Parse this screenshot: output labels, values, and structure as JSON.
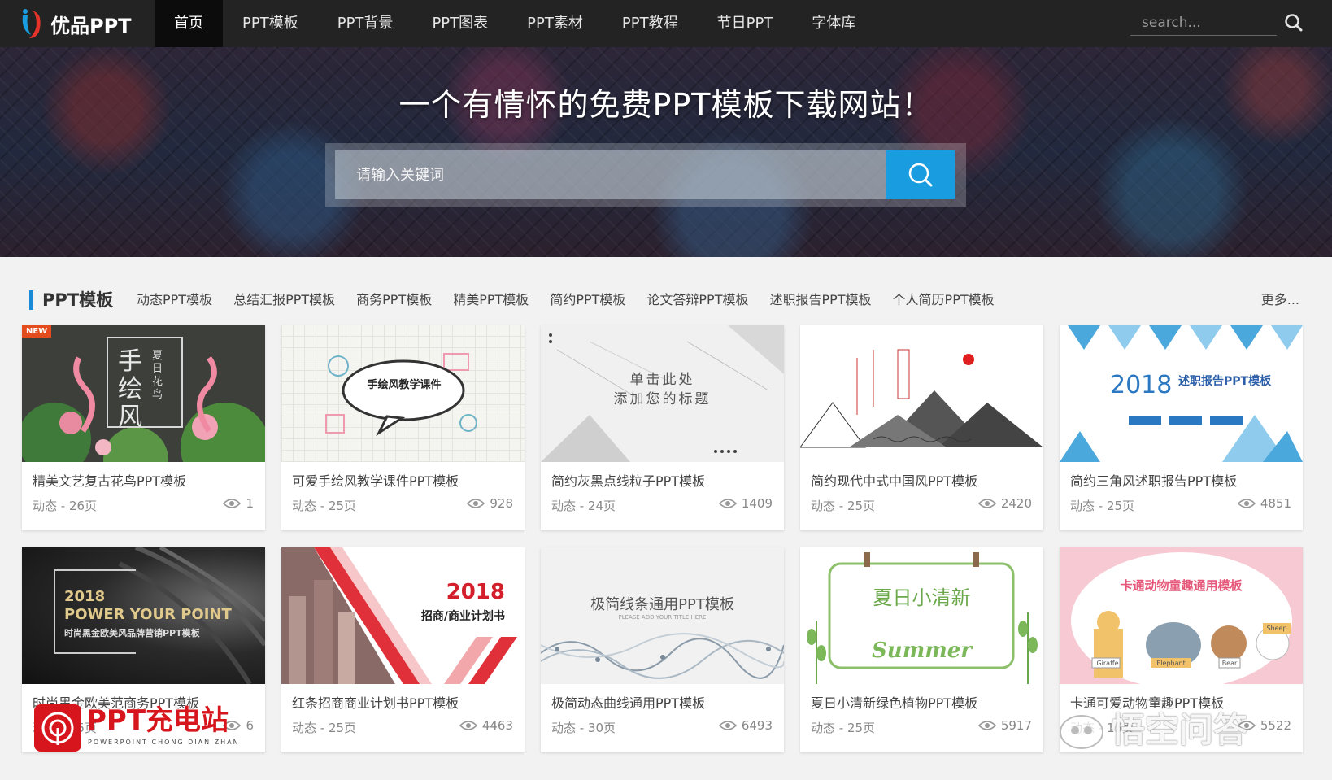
{
  "nav": {
    "logo_text": "优品PPT",
    "items": [
      {
        "label": "首页"
      },
      {
        "label": "PPT模板"
      },
      {
        "label": "PPT背景"
      },
      {
        "label": "PPT图表"
      },
      {
        "label": "PPT素材"
      },
      {
        "label": "PPT教程"
      },
      {
        "label": "节日PPT"
      },
      {
        "label": "字体库"
      }
    ],
    "search_placeholder": "search..."
  },
  "hero": {
    "title": "一个有情怀的免费PPT模板下载网站！",
    "search_placeholder": "请输入关键词"
  },
  "category": {
    "title": "PPT模板",
    "links": [
      "动态PPT模板",
      "总结汇报PPT模板",
      "商务PPT模板",
      "精美PPT模板",
      "简约PPT模板",
      "论文答辩PPT模板",
      "述职报告PPT模板",
      "个人简历PPT模板"
    ],
    "more": "更多..."
  },
  "cards": [
    {
      "title": "精美文艺复古花鸟PPT模板",
      "meta": "动态 - 26页",
      "views": "1",
      "badge": "NEW",
      "thumb_text": [
        "手绘风",
        "夏日花鸟"
      ]
    },
    {
      "title": "可爱手绘风教学课件PPT模板",
      "meta": "动态 - 25页",
      "views": "928",
      "thumb_text": [
        "手绘风教学课件"
      ]
    },
    {
      "title": "简约灰黑点线粒子PPT模板",
      "meta": "动态 - 24页",
      "views": "1409",
      "thumb_text": [
        "单击此处",
        "添加您的标题"
      ]
    },
    {
      "title": "简约现代中式中国风PPT模板",
      "meta": "动态 - 25页",
      "views": "2420",
      "thumb_text": []
    },
    {
      "title": "简约三角风述职报告PPT模板",
      "meta": "动态 - 25页",
      "views": "4851",
      "thumb_text": [
        "2018",
        "述职报告PPT模板"
      ]
    },
    {
      "title": "时尚黑金欧美范商务PPT模板",
      "meta": "动态 - 25页",
      "views": "6",
      "thumb_text": [
        "2018",
        "POWER YOUR POINT",
        "时尚黑金欧美风品牌营销PPT模板"
      ]
    },
    {
      "title": "红条招商商业计划书PPT模板",
      "meta": "动态 - 25页",
      "views": "4463",
      "thumb_text": [
        "2018",
        "招商/商业计划书"
      ]
    },
    {
      "title": "极简动态曲线通用PPT模板",
      "meta": "动态 - 30页",
      "views": "6493",
      "thumb_text": [
        "极简线条通用PPT模板",
        "PLEASE ADD YOUR TITLE HERE"
      ]
    },
    {
      "title": "夏日小清新绿色植物PPT模板",
      "meta": "动态 - 25页",
      "views": "5917",
      "thumb_text": [
        "夏日小清新",
        "Summer"
      ]
    },
    {
      "title": "卡通可爱动物童趣PPT模板",
      "meta": "动态 - 15页",
      "views": "5522",
      "thumb_text": [
        "卡通动物童趣通用模板",
        "Giraffe",
        "Elephant",
        "Bear",
        "Sheep"
      ]
    }
  ],
  "watermarks": {
    "left_text": "PPT充电站",
    "left_sub": "POWERPOINT CHONG DIAN ZHAN",
    "right_text": "悟空问答"
  },
  "colors": {
    "nav_bg": "#232323",
    "accent": "#1a9ce0",
    "category_marker": "#1a8ad6",
    "watermark_red": "#d7151c"
  }
}
